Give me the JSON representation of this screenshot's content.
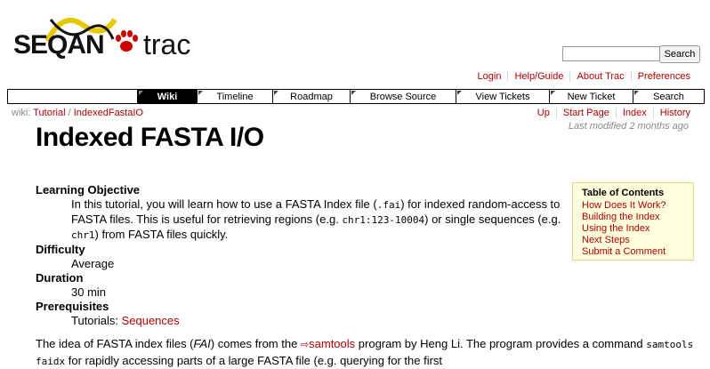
{
  "header": {
    "logo_seqan": "SEQAN",
    "logo_trac": "trac",
    "search_value": "",
    "search_button": "Search"
  },
  "metanav": [
    "Login",
    "Help/Guide",
    "About Trac",
    "Preferences"
  ],
  "mainnav": [
    {
      "label": "Wiki",
      "active": true
    },
    {
      "label": "Timeline"
    },
    {
      "label": "Roadmap"
    },
    {
      "label": "Browse Source"
    },
    {
      "label": "View Tickets"
    },
    {
      "label": "New Ticket"
    },
    {
      "label": "Search"
    }
  ],
  "breadcrumb": {
    "prefix": "wiki:",
    "part1": "Tutorial",
    "sep": " / ",
    "part2": "IndexedFastaIO"
  },
  "ctxnav": [
    "Up",
    "Start Page",
    "Index",
    "History"
  ],
  "last_modified": "Last modified 2 months ago",
  "page_title": "Indexed FASTA I/O",
  "toc": {
    "title": "Table of Contents",
    "items": [
      "How Does It Work?",
      "Building the Index",
      "Using the Index",
      "Next Steps",
      "Submit a Comment"
    ]
  },
  "learning_objective": {
    "label": "Learning Objective",
    "t1": "In this tutorial, you will learn how to use a FASTA Index file (",
    "c1": ".fai",
    "t2": ") for indexed random-access to FASTA files. This is useful for retrieving regions (e.g. ",
    "c2": "chr1:123-10004",
    "t3": ") or single sequences (e.g. ",
    "c3": "chr1",
    "t4": ") from FASTA files quickly."
  },
  "difficulty": {
    "label": "Difficulty",
    "value": "Average"
  },
  "duration": {
    "label": "Duration",
    "value": "30 min"
  },
  "prerequisites": {
    "label": "Prerequisites",
    "prefix": "Tutorials: ",
    "link": "Sequences"
  },
  "intro": {
    "t1": "The idea of FASTA index files (",
    "em": "FAI",
    "t2": ") comes from the ",
    "link": "samtools",
    "t3": " program by Heng Li. The program provides a command ",
    "c1": "samtools faidx",
    "t4": " for rapidly accessing parts of a large FASTA file (e.g. querying for the first"
  }
}
